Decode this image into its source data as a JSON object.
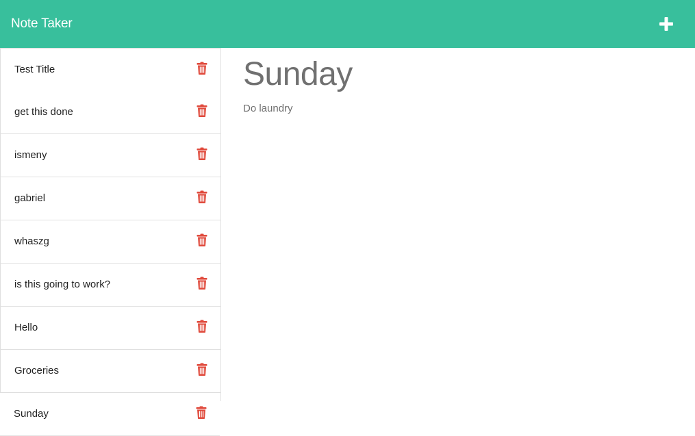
{
  "navbar": {
    "brand": "Note Taker",
    "add_icon": "plus-icon"
  },
  "sidebar": {
    "delete_icon": "trash-icon",
    "items": [
      {
        "title": "Test Title"
      },
      {
        "title": "get this done"
      },
      {
        "title": "ismeny"
      },
      {
        "title": "gabriel"
      },
      {
        "title": "whaszg"
      },
      {
        "title": "is this going to work?"
      },
      {
        "title": "Hello"
      },
      {
        "title": "Groceries"
      },
      {
        "title": "Sunday"
      }
    ]
  },
  "note_view": {
    "title": "Sunday",
    "text": "Do laundry"
  },
  "colors": {
    "navbar": "#38bf9c",
    "delete": "#e04a3c",
    "title_text": "#707070"
  }
}
